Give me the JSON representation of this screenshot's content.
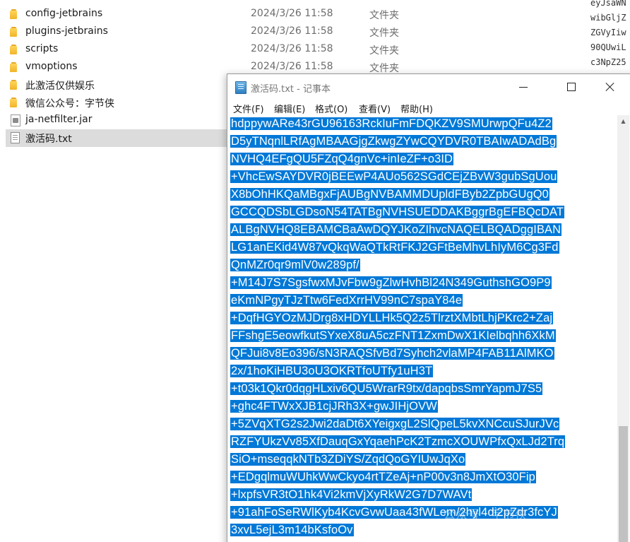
{
  "explorer": {
    "files": [
      {
        "name": "config-jetbrains",
        "date": "2024/3/26 11:58",
        "type": "文件夹",
        "icon": "folder-icon"
      },
      {
        "name": "plugins-jetbrains",
        "date": "2024/3/26 11:58",
        "type": "文件夹",
        "icon": "folder-icon"
      },
      {
        "name": "scripts",
        "date": "2024/3/26 11:58",
        "type": "文件夹",
        "icon": "folder-icon"
      },
      {
        "name": "vmoptions",
        "date": "2024/3/26 11:58",
        "type": "文件夹",
        "icon": "folder-icon"
      },
      {
        "name": "此激活仅供娱乐",
        "date": "",
        "type": "",
        "icon": "folder-icon"
      },
      {
        "name": "微信公众号：字节侠",
        "date": "",
        "type": "",
        "icon": "folder-icon"
      },
      {
        "name": "ja-netfilter.jar",
        "date": "",
        "type": "",
        "icon": "jar-icon"
      },
      {
        "name": "激活码.txt",
        "date": "",
        "type": "",
        "icon": "txt-icon",
        "selected": true
      }
    ]
  },
  "background_text": {
    "lines": [
      "eyJsaWN",
      "wibGljZ",
      "ZGVyIiw",
      "90QUwiL",
      "c3NpZ25"
    ]
  },
  "notepad": {
    "title": "激活码.txt - 记事本",
    "menu": [
      "文件(F)",
      "编辑(E)",
      "格式(O)",
      "查看(V)",
      "帮助(H)"
    ],
    "selection_color": "#0078d7",
    "lines": [
      "hdppywARe43rGU96163RckIuFmFDQKZV9SMUrwpQFu4Z2",
      "D5yTNqnlLRfAgMBAAGjgZkwgZYwCQYDVR0TBAIwADAdBg",
      "NVHQ4EFgQU5FZqQ4gnVc+inIeZF+o3ID",
      "+VhcEwSAYDVR0jBEEwP4AUo562SGdCEjZBvW3gubSgUou",
      "X8bOhHKQaMBgxFjAUBgNVBAMMDUpldFByb2ZpbGUgQ0",
      "GCCQDSbLGDsoN54TATBgNVHSUEDDAKBggrBgEFBQcDAT",
      "ALBgNVHQ8EBAMCBaAwDQYJKoZIhvcNAQELBQADggIBAN",
      "LG1anEKid4W87vQkqWaQTkRtFKJ2GFtBeMhvLhIyM6Cg3Fd",
      "QnMZr0qr9mlV0w289pf/",
      "+M14J7S7SgsfwxMJvFbw9gZlwHvhBl24N349GuthshGO9P9",
      "eKmNPgyTJzTtw6FedXrrHV99nC7spaY84e",
      "+DqfHGYOzMJDrg8xHDYLLHk5Q2z5TlrztXMbtLhjPKrc2+Zaj",
      "FFshgE5eowfkutSYxeX8uA5czFNT1ZxmDwX1KIelbqhh6XkM",
      "QFJui8v8Eo396/sN3RAQSfvBd7Syhch2vlaMP4FAB11AlMKO",
      "2x/1hoKiHBU3oU3OKRTfoUTfy1uH3T",
      "+t03k1Qkr0dqgHLxiv6QU5WrarR9tx/dapqbsSmrYapmJ7S5",
      "+ghc4FTWxXJB1cjJRh3X+gwJIHjOVW",
      "+5ZVqXTG2s2Jwi2daDt6XYeigxgL2SlQpeL5kvXNCcuSJurJVc",
      "RZFYUkzVv85XfDauqGxYqaehPcK2TzmcXOUWPfxQxLJd2Trq",
      "SiO+mseqqkNTb3ZDiYS/ZqdQoGYIUwJqXo",
      "+EDgqlmuWUhkWwCkyo4rtTZeAj+nP00v3n8JmXtO30Fip",
      "+lxpfsVR3tO1hk4Vi2kmVjXyRkW2G7D7WAVt",
      "+91ahFoSeRWlKyb4KcvGvwUaa43fWLem/2hyl4di2pZdr3fcYJ",
      "3xvL5ejL3m14bKsfoOv"
    ]
  },
  "watermark": {
    "text": "公众号 · 字节侠"
  }
}
